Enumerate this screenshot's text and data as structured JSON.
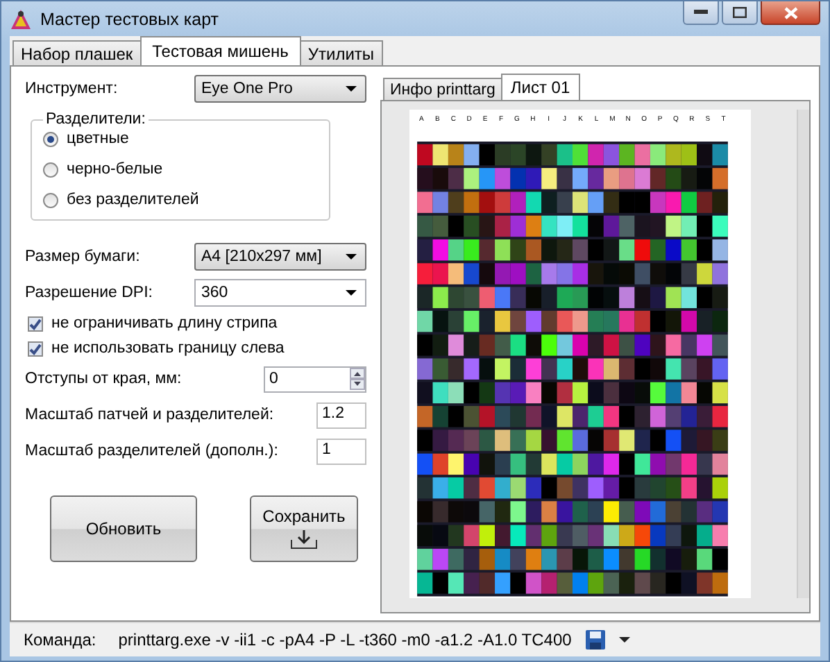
{
  "window": {
    "title": "Мастер тестовых карт"
  },
  "tabs": [
    {
      "label": "Набор плашек",
      "selected": false
    },
    {
      "label": "Тестовая мишень",
      "selected": true
    },
    {
      "label": "Утилиты",
      "selected": false
    }
  ],
  "instrument": {
    "label": "Инструмент:",
    "value": "Eye One Pro"
  },
  "separators": {
    "title": "Разделители:",
    "options": [
      {
        "label": "цветные",
        "selected": true
      },
      {
        "label": "черно-белые",
        "selected": false
      },
      {
        "label": "без разделителей",
        "selected": false
      }
    ]
  },
  "paper_size": {
    "label": "Размер бумаги:",
    "value": "A4 [210x297 мм]"
  },
  "dpi": {
    "label": "Разрешение DPI:",
    "value": "360"
  },
  "checkboxes": [
    {
      "label": "не ограничивать длину стрипа",
      "checked": true
    },
    {
      "label": "не использовать границу слева",
      "checked": true
    }
  ],
  "margin": {
    "label": "Отступы от края, мм:",
    "value": "0"
  },
  "patch_scale": {
    "label": "Масштаб патчей и разделителей:",
    "value": "1.2"
  },
  "separator_scale": {
    "label": "Масштаб разделителей (дополн.):",
    "value": "1"
  },
  "buttons": [
    {
      "kind": "plain",
      "label": "Обновить"
    },
    {
      "kind": "save",
      "label": "Сохранить"
    }
  ],
  "preview_tabs": [
    {
      "label": "Инфо printtarg",
      "selected": false
    },
    {
      "label": "Лист 01",
      "selected": true
    }
  ],
  "preview": {
    "column_labels": [
      "A",
      "B",
      "C",
      "D",
      "E",
      "F",
      "G",
      "H",
      "I",
      "J",
      "K",
      "L",
      "M",
      "N",
      "O",
      "P",
      "Q",
      "R",
      "S",
      "T"
    ]
  },
  "status_bar": {
    "label": "Команда:",
    "command": "printtarg.exe -v -ii1 -c -pA4 -P -L -t360 -m0 -a1.2 -A1.0 TC400"
  }
}
